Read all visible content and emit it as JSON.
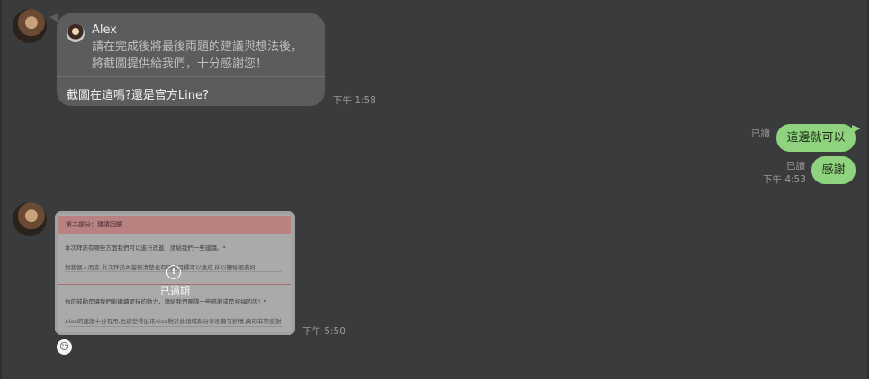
{
  "messages": {
    "incoming_reply": {
      "quote_author": "Alex",
      "quote_text": "請在完成後將最後兩題的建議與想法後，\n將截圖提供給我們，十分感謝您！",
      "reply_text": "截圖在這嗎?還是官方Line?",
      "time": "下午 1:58"
    },
    "outgoing_1": {
      "read_label": "已讀",
      "text": "這邊就可以"
    },
    "outgoing_2": {
      "read_label": "已讀",
      "time": "下午 4:53",
      "text": "感謝"
    },
    "incoming_image": {
      "status": "已過期",
      "time": "下午 5:50",
      "preview_header": "第二部分：建議回饋",
      "preview_q1": "本次拜訪有哪些方面我們可以進行改進，請給我們一些建議。*",
      "preview_a1": "對我個人而言,此次拜訪內容很清楚也有明確目標可以達成,所以體驗很美好",
      "preview_q2": "你的鼓勵是讓我們能繼續堅持的動力，請給我們團隊一些感謝或是祝福的話！*",
      "preview_a2": "Alex的建議十分有用,也感受得出來Alex對於此領域與分享很著有熱情,真的非常感謝!"
    }
  },
  "colors": {
    "background": "#3a3b3c",
    "incoming_bubble": "#5b5c5e",
    "outgoing_bubble": "#8fd37e"
  },
  "icons": {
    "expired": "exclamation-circle-icon",
    "reaction": "sticker-face-icon"
  }
}
